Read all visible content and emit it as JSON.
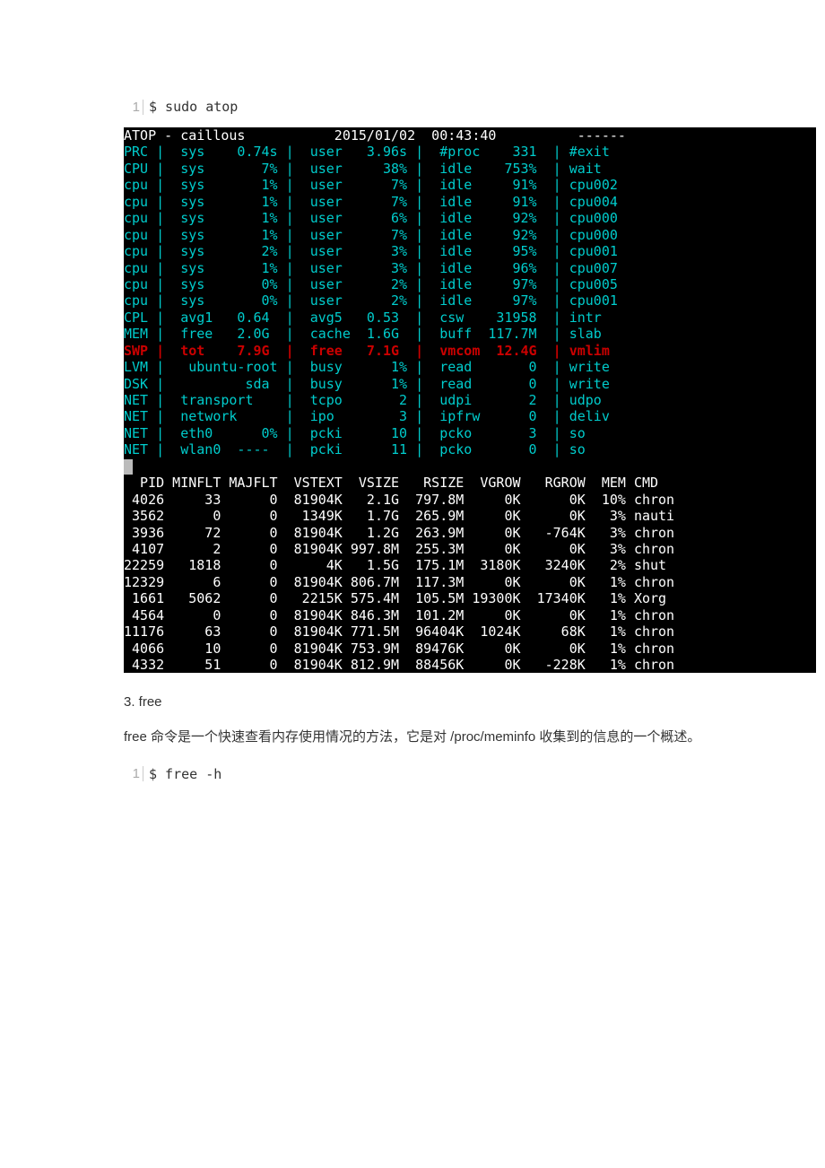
{
  "code1": {
    "lineno": "1",
    "text": "$ sudo atop"
  },
  "atop": {
    "header": "ATOP - caillous           2015/01/02  00:43:40          ------       ",
    "rows": [
      "PRC |  sys    0.74s |  user   3.96s |  #proc    331  | #exit",
      "CPU |  sys       7% |  user     38% |  idle    753%  | wait ",
      "cpu |  sys       1% |  user      7% |  idle     91%  | cpu002",
      "cpu |  sys       1% |  user      7% |  idle     91%  | cpu004",
      "cpu |  sys       1% |  user      6% |  idle     92%  | cpu000",
      "cpu |  sys       1% |  user      7% |  idle     92%  | cpu000",
      "cpu |  sys       2% |  user      3% |  idle     95%  | cpu001",
      "cpu |  sys       1% |  user      3% |  idle     96%  | cpu007",
      "cpu |  sys       0% |  user      2% |  idle     97%  | cpu005",
      "cpu |  sys       0% |  user      2% |  idle     97%  | cpu001",
      "CPL |  avg1   0.64  |  avg5   0.53  |  csw    31958  | intr ",
      "MEM |  free   2.0G  |  cache  1.6G  |  buff  117.7M  | slab "
    ],
    "swp_row": "SWP |  tot    7.9G  |  free   7.1G  |  vmcom  12.4G  | vmlim",
    "rows2": [
      "LVM |   ubuntu-root |  busy      1% |  read       0  | write",
      "DSK |          sda  |  busy      1% |  read       0  | write",
      "NET |  transport    |  tcpo       2 |  udpi       2  | udpo ",
      "NET |  network      |  ipo        3 |  ipfrw      0  | deliv",
      "NET |  eth0      0% |  pcki      10 |  pcko       3  | so   ",
      "NET |  wlan0  ----  |  pcki      11 |  pcko       0  | so   "
    ],
    "proc_header": "  PID MINFLT MAJFLT  VSTEXT  VSIZE   RSIZE  VGROW   RGROW  MEM CMD ",
    "procs": [
      " 4026     33      0  81904K   2.1G  797.8M     0K      0K  10% chron",
      " 3562      0      0   1349K   1.7G  265.9M     0K      0K   3% nauti",
      " 3936     72      0  81904K   1.2G  263.9M     0K   -764K   3% chron",
      " 4107      2      0  81904K 997.8M  255.3M     0K      0K   3% chron",
      "22259   1818      0      4K   1.5G  175.1M  3180K   3240K   2% shut",
      "12329      6      0  81904K 806.7M  117.3M     0K      0K   1% chron",
      " 1661   5062      0   2215K 575.4M  105.5M 19300K  17340K   1% Xorg",
      " 4564      0      0  81904K 846.3M  101.2M     0K      0K   1% chron",
      "11176     63      0  81904K 771.5M  96404K  1024K     68K   1% chron",
      " 4066     10      0  81904K 753.9M  89476K     0K      0K   1% chron",
      " 4332     51      0  81904K 812.9M  88456K     0K   -228K   1% chron"
    ]
  },
  "section3": {
    "title": "3. free"
  },
  "para": "free 命令是一个快速查看内存使用情况的方法，它是对  /proc/meminfo  收集到的信息的一个概述。",
  "code2": {
    "lineno": "1",
    "text": "$ free -h"
  },
  "chart_data": {
    "type": "table",
    "title": "atop process list",
    "columns": [
      "PID",
      "MINFLT",
      "MAJFLT",
      "VSTEXT",
      "VSIZE",
      "RSIZE",
      "VGROW",
      "RGROW",
      "MEM",
      "CMD"
    ],
    "rows": [
      [
        "4026",
        "33",
        "0",
        "81904K",
        "2.1G",
        "797.8M",
        "0K",
        "0K",
        "10%",
        "chron"
      ],
      [
        "3562",
        "0",
        "0",
        "1349K",
        "1.7G",
        "265.9M",
        "0K",
        "0K",
        "3%",
        "nauti"
      ],
      [
        "3936",
        "72",
        "0",
        "81904K",
        "1.2G",
        "263.9M",
        "0K",
        "-764K",
        "3%",
        "chron"
      ],
      [
        "4107",
        "2",
        "0",
        "81904K",
        "997.8M",
        "255.3M",
        "0K",
        "0K",
        "3%",
        "chron"
      ],
      [
        "22259",
        "1818",
        "0",
        "4K",
        "1.5G",
        "175.1M",
        "3180K",
        "3240K",
        "2%",
        "shut"
      ],
      [
        "12329",
        "6",
        "0",
        "81904K",
        "806.7M",
        "117.3M",
        "0K",
        "0K",
        "1%",
        "chron"
      ],
      [
        "1661",
        "5062",
        "0",
        "2215K",
        "575.4M",
        "105.5M",
        "19300K",
        "17340K",
        "1%",
        "Xorg"
      ],
      [
        "4564",
        "0",
        "0",
        "81904K",
        "846.3M",
        "101.2M",
        "0K",
        "0K",
        "1%",
        "chron"
      ],
      [
        "11176",
        "63",
        "0",
        "81904K",
        "771.5M",
        "96404K",
        "1024K",
        "68K",
        "1%",
        "chron"
      ],
      [
        "4066",
        "10",
        "0",
        "81904K",
        "753.9M",
        "89476K",
        "0K",
        "0K",
        "1%",
        "chron"
      ],
      [
        "4332",
        "51",
        "0",
        "81904K",
        "812.9M",
        "88456K",
        "0K",
        "-228K",
        "1%",
        "chron"
      ]
    ]
  }
}
